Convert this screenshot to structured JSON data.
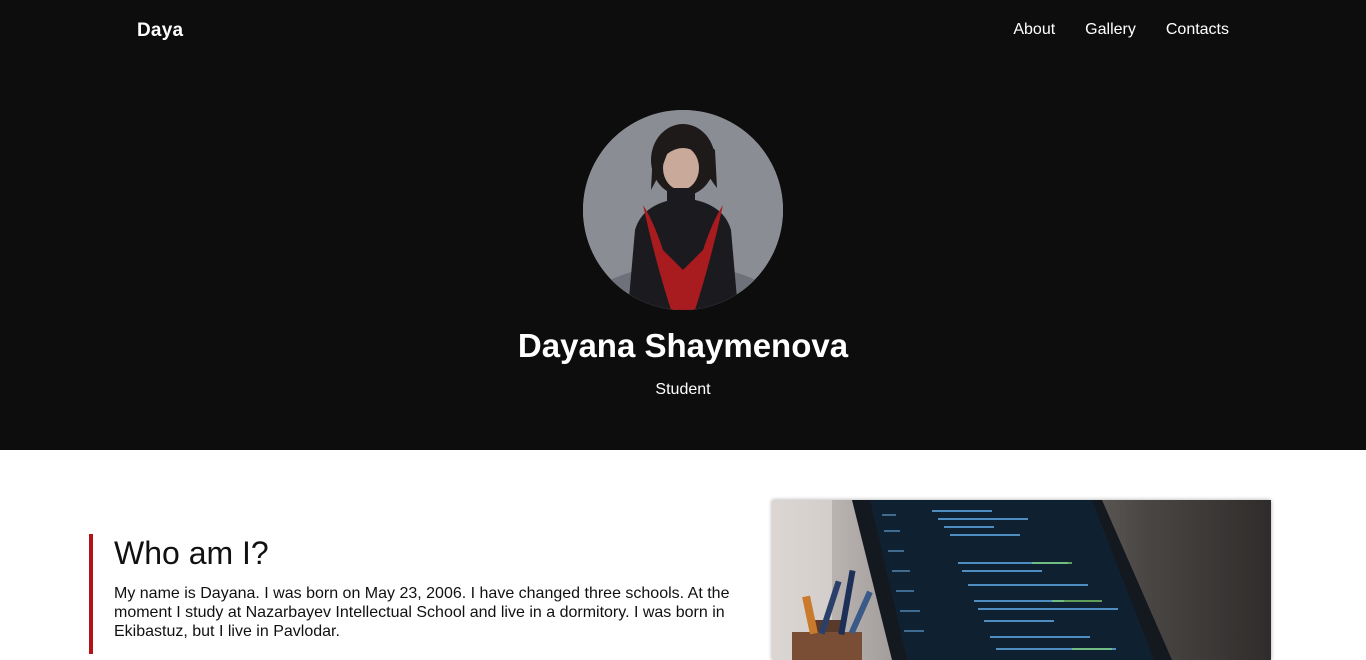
{
  "nav": {
    "brand": "Daya",
    "links": [
      {
        "label": "About"
      },
      {
        "label": "Gallery"
      },
      {
        "label": "Contacts"
      }
    ]
  },
  "hero": {
    "name": "Dayana Shaymenova",
    "role": "Student"
  },
  "about": {
    "title": "Who am I?",
    "text": "My name is Dayana. I was born on May 23, 2006. I have changed three schools. At the moment I study at Nazarbayev Intellectual School and live in a dormitory. I was born in Ekibastuz, but I live in Pavlodar."
  },
  "colors": {
    "hero_bg": "#0d0d0d",
    "accent": "#b31217",
    "text_light": "#ffffff",
    "text_dark": "#111111"
  },
  "icons": {
    "avatar": "profile-photo",
    "feature_image": "laptop-code-photo"
  }
}
